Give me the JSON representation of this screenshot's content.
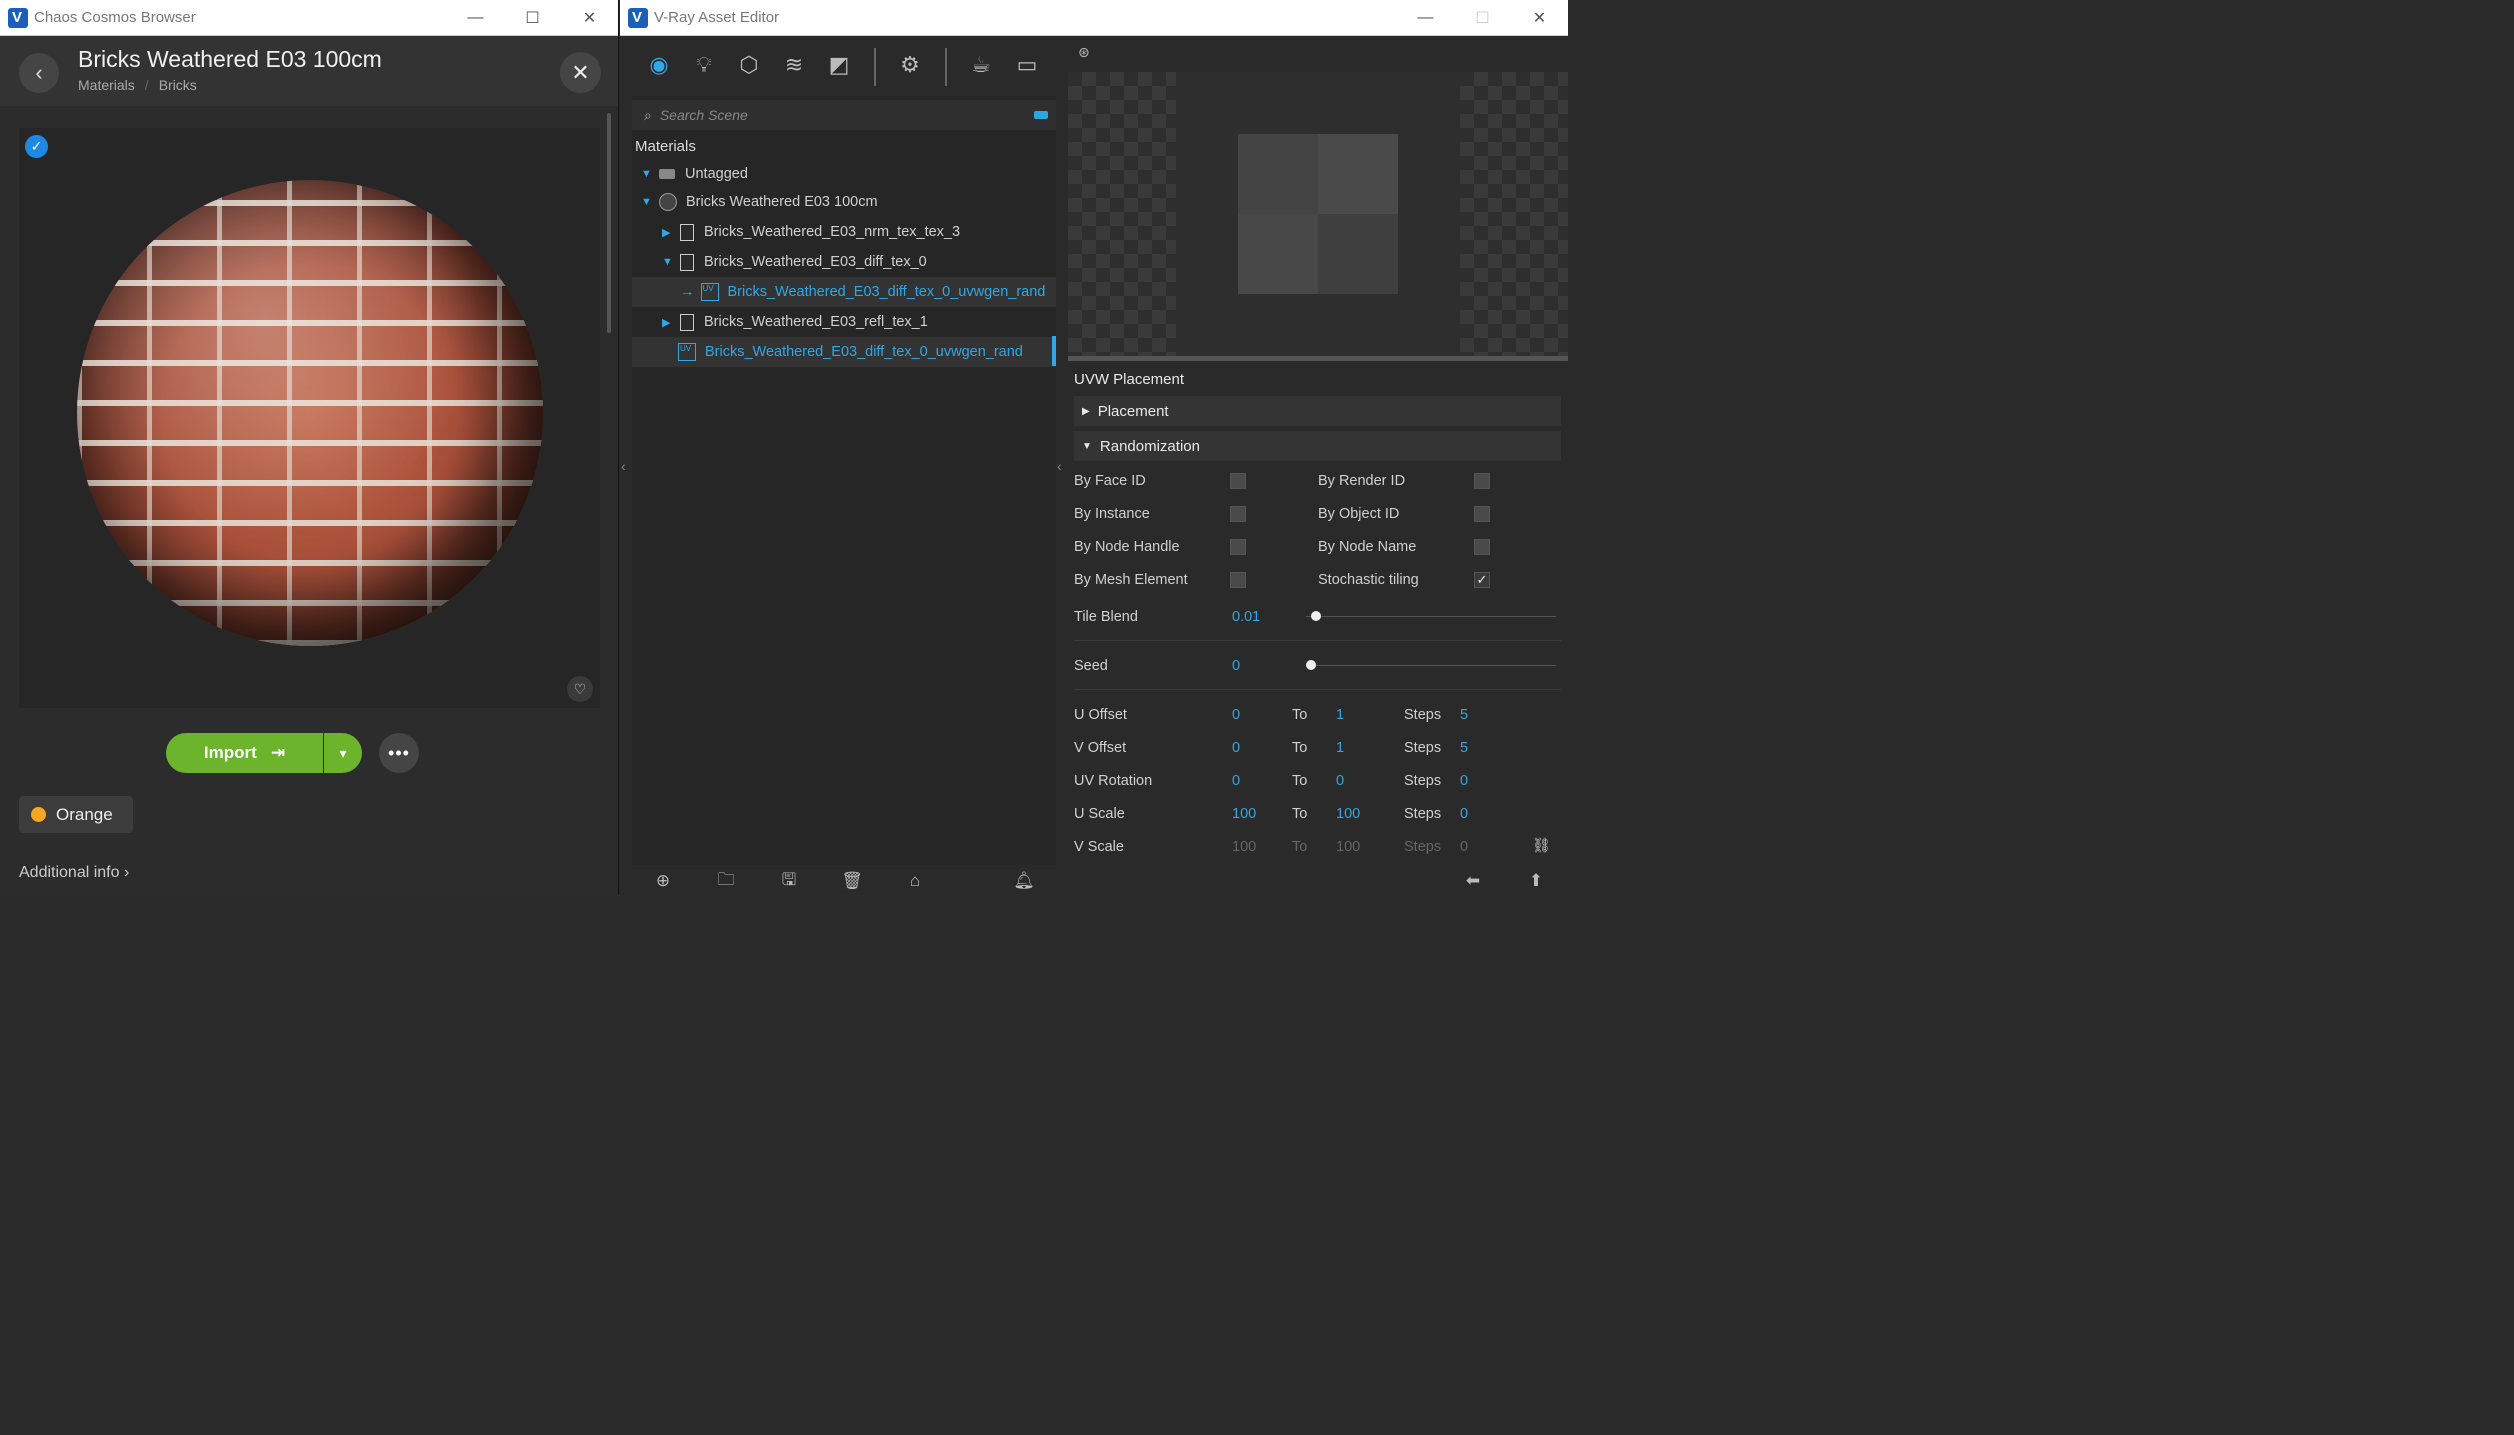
{
  "cosmos": {
    "window_title": "Chaos Cosmos Browser",
    "asset_title": "Bricks Weathered E03 100cm",
    "breadcrumb": [
      "Materials",
      "Bricks"
    ],
    "import_label": "Import",
    "tag_label": "Orange",
    "tag_color": "#f5a623",
    "additional_info": "Additional info",
    "window_controls": {
      "minimize": "—",
      "maximize": "☐",
      "close": "✕"
    }
  },
  "vray": {
    "window_title": "V-Ray Asset Editor",
    "window_controls": {
      "minimize": "—",
      "maximize": "☐",
      "close": "✕"
    },
    "toolbar_icons": [
      "materials-icon",
      "lights-icon",
      "geometry-icon",
      "layers-icon",
      "textures-icon",
      "settings-icon",
      "render-icon",
      "frame-buffer-icon"
    ],
    "search_placeholder": "Search Scene",
    "outliner_header": "Materials",
    "tree": [
      {
        "label": "Untagged",
        "indent": 0,
        "expanded": true,
        "icon": "tag-icon"
      },
      {
        "label": "Bricks Weathered E03 100cm",
        "indent": 0,
        "expanded": true,
        "icon": "material-sphere-icon"
      },
      {
        "label": "Bricks_Weathered_E03_nrm_tex_tex_3",
        "indent": 1,
        "expanded": false,
        "icon": "file-icon"
      },
      {
        "label": "Bricks_Weathered_E03_diff_tex_0",
        "indent": 1,
        "expanded": true,
        "icon": "file-icon"
      },
      {
        "label": "Bricks_Weathered_E03_diff_tex_0_uvwgen_rand",
        "indent": 2,
        "icon": "uvw-icon",
        "highlighted": true,
        "selected": true
      },
      {
        "label": "Bricks_Weathered_E03_refl_tex_1",
        "indent": 1,
        "expanded": false,
        "icon": "file-icon"
      },
      {
        "label": "Bricks_Weathered_E03_diff_tex_0_uvwgen_rand",
        "indent": 1,
        "icon": "uvw-icon",
        "highlighted": true,
        "selected": true
      }
    ],
    "props": {
      "section_title": "UVW Placement",
      "rollouts": {
        "placement": "Placement",
        "randomization": "Randomization"
      },
      "checkboxes": {
        "by_face_id": {
          "label": "By Face ID",
          "checked": false
        },
        "by_render_id": {
          "label": "By Render ID",
          "checked": false
        },
        "by_instance": {
          "label": "By Instance",
          "checked": false
        },
        "by_object_id": {
          "label": "By Object ID",
          "checked": false
        },
        "by_node_handle": {
          "label": "By Node Handle",
          "checked": false
        },
        "by_node_name": {
          "label": "By Node Name",
          "checked": false
        },
        "by_mesh_element": {
          "label": "By Mesh Element",
          "checked": false
        },
        "stochastic_tiling": {
          "label": "Stochastic tiling",
          "checked": true
        }
      },
      "tile_blend": {
        "label": "Tile Blend",
        "value": "0.01"
      },
      "seed": {
        "label": "Seed",
        "value": "0"
      },
      "ranges": [
        {
          "label": "U Offset",
          "from": "0",
          "to_label": "To",
          "to": "1",
          "steps_label": "Steps",
          "steps": "5",
          "dim": false
        },
        {
          "label": "V Offset",
          "from": "0",
          "to_label": "To",
          "to": "1",
          "steps_label": "Steps",
          "steps": "5",
          "dim": false
        },
        {
          "label": "UV Rotation",
          "from": "0",
          "to_label": "To",
          "to": "0",
          "steps_label": "Steps",
          "steps": "0",
          "dim": false
        },
        {
          "label": "U Scale",
          "from": "100",
          "to_label": "To",
          "to": "100",
          "steps_label": "Steps",
          "steps": "0",
          "dim": false
        },
        {
          "label": "V Scale",
          "from": "100",
          "to_label": "To",
          "to": "100",
          "steps_label": "Steps",
          "steps": "0",
          "dim": true
        }
      ]
    }
  }
}
